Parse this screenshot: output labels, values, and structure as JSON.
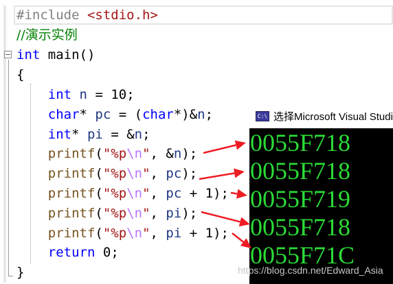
{
  "code_lines": [
    [
      {
        "t": "#include ",
        "c": "pre"
      },
      {
        "t": "<stdio.h>",
        "c": "inc"
      }
    ],
    [
      {
        "t": "//演示实例",
        "c": "com"
      }
    ],
    [
      {
        "t": "int",
        "c": "kw"
      },
      {
        "t": " main()",
        "c": "txt"
      }
    ],
    [
      {
        "t": "{",
        "c": "txt"
      }
    ],
    [
      {
        "t": "    ",
        "c": "txt"
      },
      {
        "t": "int",
        "c": "kw"
      },
      {
        "t": " ",
        "c": "txt"
      },
      {
        "t": "n",
        "c": "var"
      },
      {
        "t": " = ",
        "c": "txt"
      },
      {
        "t": "10",
        "c": "num"
      },
      {
        "t": ";",
        "c": "txt"
      }
    ],
    [
      {
        "t": "    ",
        "c": "txt"
      },
      {
        "t": "char",
        "c": "kw"
      },
      {
        "t": "* ",
        "c": "txt"
      },
      {
        "t": "pc",
        "c": "var"
      },
      {
        "t": " = (",
        "c": "txt"
      },
      {
        "t": "char",
        "c": "kw"
      },
      {
        "t": "*)&",
        "c": "txt"
      },
      {
        "t": "n",
        "c": "var"
      },
      {
        "t": ";",
        "c": "txt"
      }
    ],
    [
      {
        "t": "    ",
        "c": "txt"
      },
      {
        "t": "int",
        "c": "kw"
      },
      {
        "t": "* ",
        "c": "txt"
      },
      {
        "t": "pi",
        "c": "var"
      },
      {
        "t": " = &",
        "c": "txt"
      },
      {
        "t": "n",
        "c": "var"
      },
      {
        "t": ";",
        "c": "txt"
      }
    ],
    [
      {
        "t": "    ",
        "c": "txt"
      },
      {
        "t": "printf",
        "c": "fn"
      },
      {
        "t": "(",
        "c": "txt"
      },
      {
        "t": "\"%p",
        "c": "str"
      },
      {
        "t": "\\n",
        "c": "esc"
      },
      {
        "t": "\"",
        "c": "str"
      },
      {
        "t": ", &",
        "c": "txt"
      },
      {
        "t": "n",
        "c": "var"
      },
      {
        "t": ");",
        "c": "txt"
      }
    ],
    [
      {
        "t": "    ",
        "c": "txt"
      },
      {
        "t": "printf",
        "c": "fn"
      },
      {
        "t": "(",
        "c": "txt"
      },
      {
        "t": "\"%p",
        "c": "str"
      },
      {
        "t": "\\n",
        "c": "esc"
      },
      {
        "t": "\"",
        "c": "str"
      },
      {
        "t": ", ",
        "c": "txt"
      },
      {
        "t": "pc",
        "c": "var"
      },
      {
        "t": ");",
        "c": "txt"
      }
    ],
    [
      {
        "t": "    ",
        "c": "txt"
      },
      {
        "t": "printf",
        "c": "fn"
      },
      {
        "t": "(",
        "c": "txt"
      },
      {
        "t": "\"%p",
        "c": "str"
      },
      {
        "t": "\\n",
        "c": "esc"
      },
      {
        "t": "\"",
        "c": "str"
      },
      {
        "t": ", ",
        "c": "txt"
      },
      {
        "t": "pc",
        "c": "var"
      },
      {
        "t": " + ",
        "c": "txt"
      },
      {
        "t": "1",
        "c": "num"
      },
      {
        "t": ");",
        "c": "txt"
      }
    ],
    [
      {
        "t": "    ",
        "c": "txt"
      },
      {
        "t": "printf",
        "c": "fn"
      },
      {
        "t": "(",
        "c": "txt"
      },
      {
        "t": "\"%p",
        "c": "str"
      },
      {
        "t": "\\n",
        "c": "esc"
      },
      {
        "t": "\"",
        "c": "str"
      },
      {
        "t": ", ",
        "c": "txt"
      },
      {
        "t": "pi",
        "c": "var"
      },
      {
        "t": ");",
        "c": "txt"
      }
    ],
    [
      {
        "t": "    ",
        "c": "txt"
      },
      {
        "t": "printf",
        "c": "fn"
      },
      {
        "t": "(",
        "c": "txt"
      },
      {
        "t": "\"%p",
        "c": "str"
      },
      {
        "t": "\\n",
        "c": "esc"
      },
      {
        "t": "\"",
        "c": "str"
      },
      {
        "t": ", ",
        "c": "txt"
      },
      {
        "t": "pi",
        "c": "var"
      },
      {
        "t": " + ",
        "c": "txt"
      },
      {
        "t": "1",
        "c": "num"
      },
      {
        "t": ");",
        "c": "txt"
      }
    ],
    [
      {
        "t": "    ",
        "c": "txt"
      },
      {
        "t": "return",
        "c": "kw"
      },
      {
        "t": " ",
        "c": "txt"
      },
      {
        "t": "0",
        "c": "num"
      },
      {
        "t": ";",
        "c": "txt"
      }
    ],
    [
      {
        "t": "}",
        "c": "txt"
      }
    ]
  ],
  "fold_toggle": "−",
  "console": {
    "icon": "C:\\",
    "title": "选择Microsoft Visual Studio 调试控制台",
    "output": [
      "0055F718",
      "0055F718",
      "0055F719",
      "0055F718",
      "0055F71C"
    ]
  },
  "arrow_color": "#ee1c24",
  "watermark": "https://blog.csdn.net/Edward_Asia"
}
